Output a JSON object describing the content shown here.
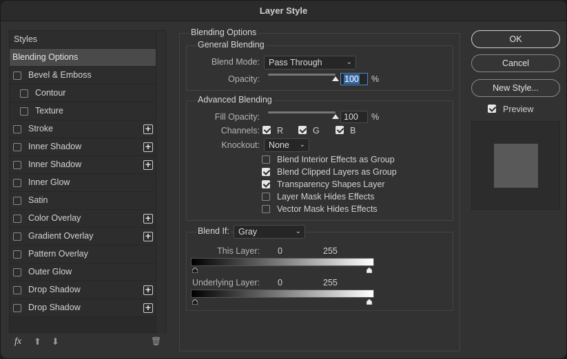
{
  "window": {
    "title": "Layer Style"
  },
  "styles_list": {
    "header": "Styles",
    "selected": "Blending Options",
    "items": [
      {
        "label": "Bevel & Emboss",
        "indent": false,
        "plus": false,
        "checked": false
      },
      {
        "label": "Contour",
        "indent": true,
        "plus": false,
        "checked": false
      },
      {
        "label": "Texture",
        "indent": true,
        "plus": false,
        "checked": false
      },
      {
        "label": "Stroke",
        "indent": false,
        "plus": true,
        "checked": false
      },
      {
        "label": "Inner Shadow",
        "indent": false,
        "plus": true,
        "checked": false
      },
      {
        "label": "Inner Shadow",
        "indent": false,
        "plus": true,
        "checked": false
      },
      {
        "label": "Inner Glow",
        "indent": false,
        "plus": false,
        "checked": false
      },
      {
        "label": "Satin",
        "indent": false,
        "plus": false,
        "checked": false
      },
      {
        "label": "Color Overlay",
        "indent": false,
        "plus": true,
        "checked": false
      },
      {
        "label": "Gradient Overlay",
        "indent": false,
        "plus": true,
        "checked": false
      },
      {
        "label": "Pattern Overlay",
        "indent": false,
        "plus": false,
        "checked": false
      },
      {
        "label": "Outer Glow",
        "indent": false,
        "plus": false,
        "checked": false
      },
      {
        "label": "Drop Shadow",
        "indent": false,
        "plus": true,
        "checked": false
      },
      {
        "label": "Drop Shadow",
        "indent": false,
        "plus": true,
        "checked": false
      }
    ],
    "footer": {
      "fx": "fx",
      "up": "⬆",
      "down": "⬇",
      "trash": "🗑"
    }
  },
  "blending_options": {
    "title": "Blending Options",
    "general": {
      "title": "General Blending",
      "blend_mode_label": "Blend Mode:",
      "blend_mode_value": "Pass Through",
      "opacity_label": "Opacity:",
      "opacity_value": "100",
      "opacity_fraction": 1.0,
      "percent": "%"
    },
    "advanced": {
      "title": "Advanced Blending",
      "fill_opacity_label": "Fill Opacity:",
      "fill_opacity_value": "100",
      "fill_opacity_fraction": 1.0,
      "percent": "%",
      "channels_label": "Channels:",
      "channels": [
        {
          "label": "R",
          "checked": true
        },
        {
          "label": "G",
          "checked": true
        },
        {
          "label": "B",
          "checked": true
        }
      ],
      "knockout_label": "Knockout:",
      "knockout_value": "None",
      "options": [
        {
          "label": "Blend Interior Effects as Group",
          "checked": false
        },
        {
          "label": "Blend Clipped Layers as Group",
          "checked": true
        },
        {
          "label": "Transparency Shapes Layer",
          "checked": true
        },
        {
          "label": "Layer Mask Hides Effects",
          "checked": false
        },
        {
          "label": "Vector Mask Hides Effects",
          "checked": false
        }
      ]
    },
    "blend_if": {
      "label": "Blend If:",
      "value": "Gray",
      "this_layer_label": "This Layer:",
      "this_layer_low": "0",
      "this_layer_high": "255",
      "underlying_label": "Underlying Layer:",
      "underlying_low": "0",
      "underlying_high": "255"
    }
  },
  "buttons": {
    "ok": "OK",
    "cancel": "Cancel",
    "new_style": "New Style..."
  },
  "preview": {
    "label": "Preview",
    "checked": true
  }
}
